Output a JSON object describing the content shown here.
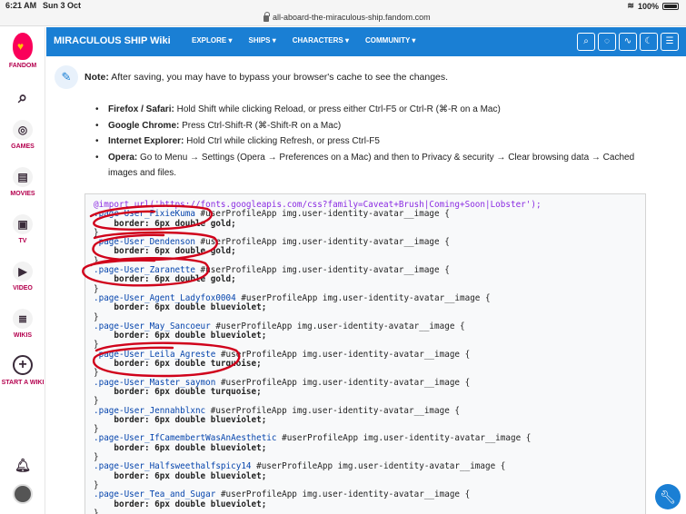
{
  "status": {
    "time": "6:21 AM",
    "date": "Sun 3 Oct",
    "battery": "100%"
  },
  "browser": {
    "url": "all-aboard-the-miraculous-ship.fandom.com"
  },
  "rail": {
    "logo_label": "FANDOM",
    "items": [
      {
        "label": "",
        "icon": "search-icon",
        "glyph": "⌕"
      },
      {
        "label": "GAMES",
        "icon": "gamepad-icon",
        "glyph": "◎"
      },
      {
        "label": "MOVIES",
        "icon": "film-icon",
        "glyph": "▤"
      },
      {
        "label": "TV",
        "icon": "tv-icon",
        "glyph": "▣"
      },
      {
        "label": "VIDEO",
        "icon": "video-icon",
        "glyph": "▶"
      },
      {
        "label": "WIKIS",
        "icon": "book-icon",
        "glyph": "≣"
      },
      {
        "label": "START A WIKI",
        "icon": "plus-icon",
        "glyph": "+"
      }
    ]
  },
  "wiki": {
    "name": "MIRACULOUS SHIP Wiki",
    "nav": [
      "EXPLORE",
      "SHIPS",
      "CHARACTERS",
      "COMMUNITY"
    ],
    "tools": [
      "⌕",
      "◌",
      "∿",
      "☾",
      "☰"
    ]
  },
  "note": {
    "label": "Note:",
    "text": "After saving, you may have to bypass your browser's cache to see the changes."
  },
  "browsers": [
    {
      "name": "Firefox / Safari:",
      "text": "Hold Shift while clicking Reload, or press either Ctrl-F5 or Ctrl-R (⌘-R on a Mac)"
    },
    {
      "name": "Google Chrome:",
      "text": "Press Ctrl-Shift-R (⌘-Shift-R on a Mac)"
    },
    {
      "name": "Internet Explorer:",
      "text": "Hold Ctrl while clicking Refresh, or press Ctrl-F5"
    },
    {
      "name": "Opera:",
      "text": "Go to Menu → Settings (Opera → Preferences on a Mac) and then to Privacy & security → Clear browsing data → Cached images and files."
    }
  ],
  "code": {
    "import": "@import url('https://fonts.googleapis.com/css?family=Caveat+Brush|Coming+Soon|Lobster');",
    "rules": [
      {
        "sel": ".page-User_PixieKuma",
        "rest": " #userProfileApp img.user-identity-avatar__image {",
        "decl": "border: 6px double gold;"
      },
      {
        "sel": ".page-User_Dendenson",
        "rest": " #userProfileApp img.user-identity-avatar__image {",
        "decl": "border: 6px double gold;"
      },
      {
        "sel": ".page-User_Zaranette",
        "rest": " #userProfileApp img.user-identity-avatar__image {",
        "decl": "border: 6px double gold;"
      },
      {
        "sel": ".page-User_Agent_Ladyfox0004",
        "rest": " #userProfileApp img.user-identity-avatar__image {",
        "decl": "border: 6px double blueviolet;"
      },
      {
        "sel": ".page-User_May_Sancoeur",
        "rest": " #userProfileApp img.user-identity-avatar__image {",
        "decl": "border: 6px double blueviolet;"
      },
      {
        "sel": ".page-User_Leila_Agreste",
        "rest": " #userProfileApp img.user-identity-avatar__image {",
        "decl": "border: 6px double turquoise;"
      },
      {
        "sel": ".page-User_Master_saymon",
        "rest": " #userProfileApp img.user-identity-avatar__image {",
        "decl": "border: 6px double turquoise;"
      },
      {
        "sel": ".page-User_Jennahblxnc",
        "rest": " #userProfileApp img.user-identity-avatar__image {",
        "decl": "border: 6px double blueviolet;"
      },
      {
        "sel": ".page-User_IfCamembertWasAnAesthetic",
        "rest": " #userProfileApp img.user-identity-avatar__image {",
        "decl": "border: 6px double blueviolet;"
      },
      {
        "sel": ".page-User_Halfsweethalfspicy14",
        "rest": " #userProfileApp img.user-identity-avatar__image {",
        "decl": "border: 6px double blueviolet;"
      },
      {
        "sel": ".page-User_Tea_and_Sugar",
        "rest": " #userProfileApp img.user-identity-avatar__image {",
        "decl": "border: 6px double blueviolet;"
      }
    ]
  },
  "colors": {
    "wiki_bar": "#1a7fd4",
    "annotation": "#d0021b",
    "fandom_pink": "#fa005a"
  }
}
